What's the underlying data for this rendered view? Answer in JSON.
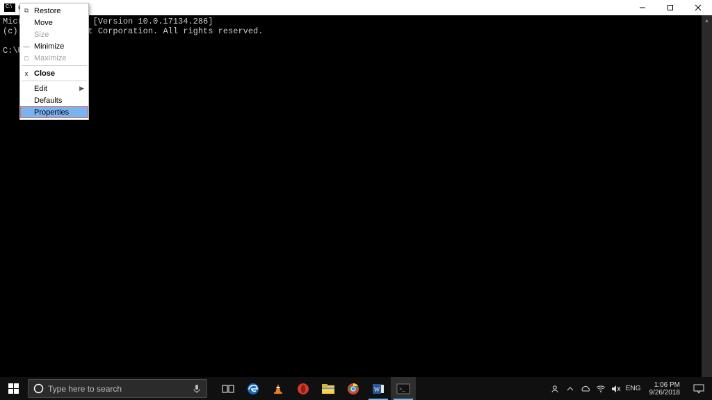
{
  "titlebar": {
    "title": "C"
  },
  "terminal": {
    "line1": "Microsoft Windows [Version 10.0.17134.286]",
    "line2": "(c) 2018 Microsoft Corporation. All rights reserved.",
    "line3": "",
    "line4": "C:\\Users>"
  },
  "sysmenu": {
    "restore": "Restore",
    "move": "Move",
    "size": "Size",
    "minimize": "Minimize",
    "maximize": "Maximize",
    "close": "Close",
    "edit": "Edit",
    "defaults": "Defaults",
    "properties": "Properties"
  },
  "taskbar": {
    "search_placeholder": "Type here to search",
    "lang": "ENG",
    "time": "1:06 PM",
    "date": "9/26/2018"
  }
}
